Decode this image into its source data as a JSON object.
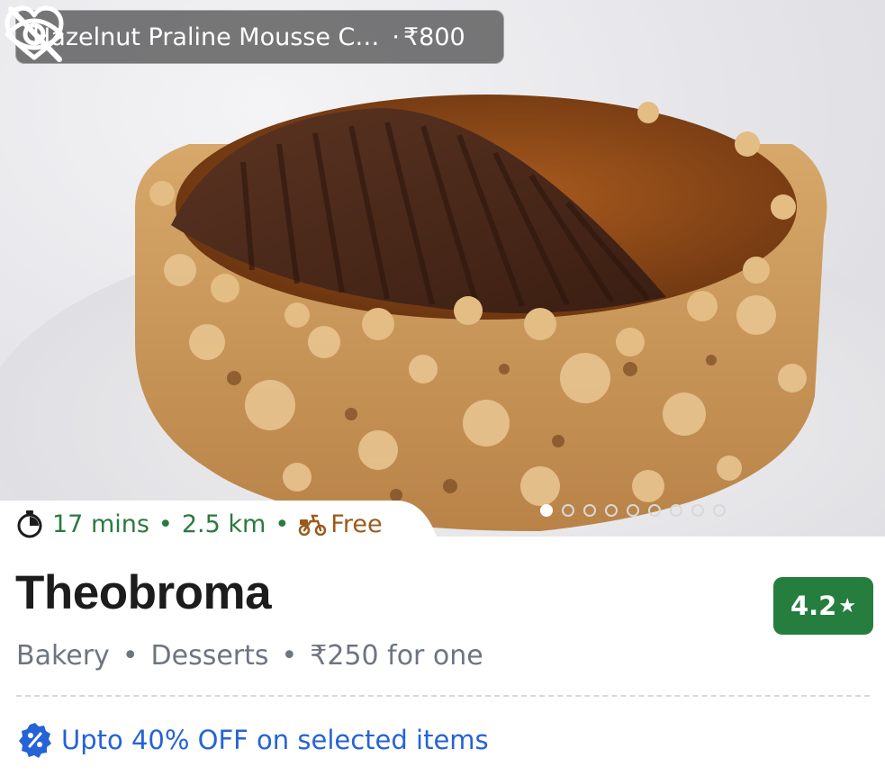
{
  "dish": {
    "name": "Hazelnut Praline Mousse C…",
    "separator": "·",
    "price": "₹800"
  },
  "actions": {
    "favorite_icon": "heart-outline-icon",
    "hide_icon": "eye-off-icon"
  },
  "delivery": {
    "time": "17 mins",
    "distance": "2.5 km",
    "fee": "Free",
    "separator": "•",
    "time_icon": "stopwatch-icon",
    "fee_icon": "scooter-icon"
  },
  "carousel": {
    "count": 9,
    "active_index": 0
  },
  "restaurant": {
    "name": "Theobroma",
    "rating": "4.2",
    "rating_star": "★",
    "cuisine_1": "Bakery",
    "cuisine_2": "Desserts",
    "cost": "₹250 for one",
    "separator": "•"
  },
  "offer": {
    "icon": "discount-badge-icon",
    "text": "Upto 40% OFF on selected items"
  },
  "colors": {
    "rating_bg": "#267e3e",
    "delivery_text": "#2b7a3e",
    "free_text": "#9a5a1c",
    "offer_text": "#2563d6"
  }
}
